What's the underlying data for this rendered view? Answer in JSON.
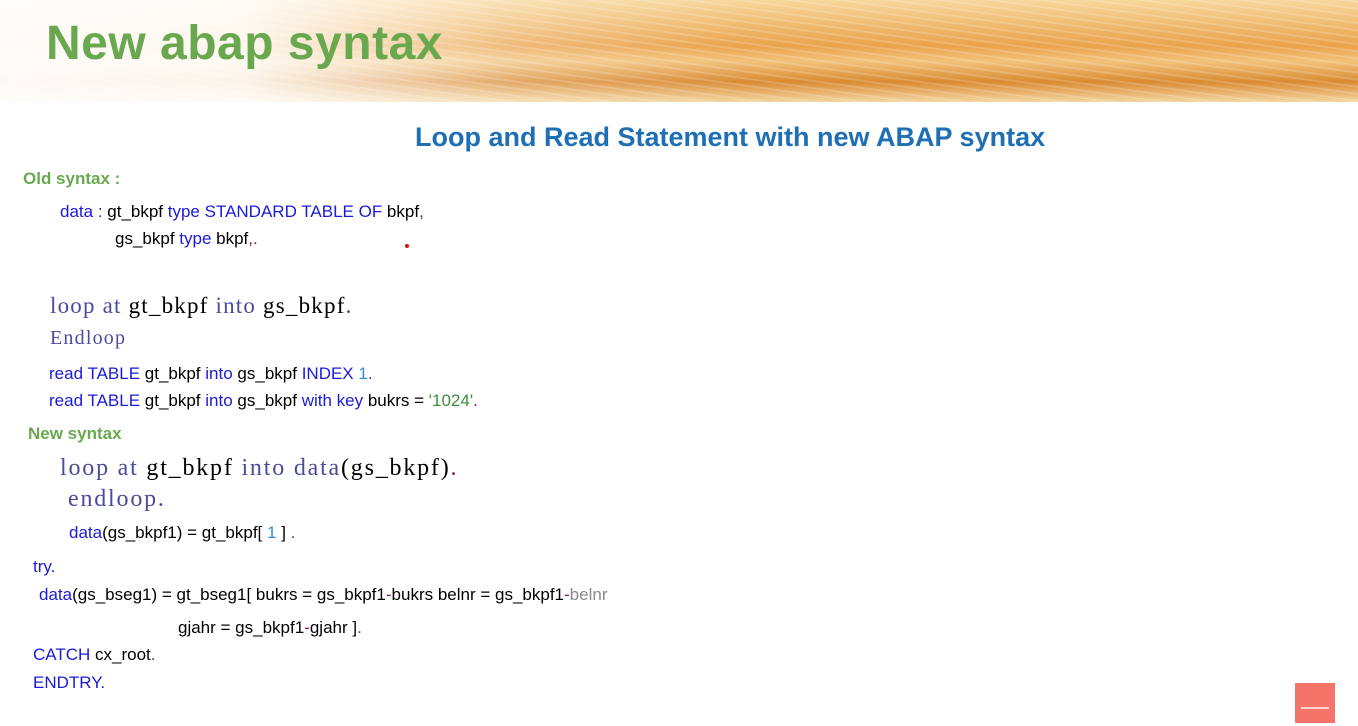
{
  "banner": {
    "title": "New abap syntax"
  },
  "subtitle": "Loop and Read Statement with new ABAP syntax",
  "old_section": {
    "label": "Old syntax :",
    "data_line1": {
      "kw": "data",
      "sep": " : ",
      "var": "gt_bkpf",
      "type_kw": " type STANDARD TABLE OF ",
      "tname": "bkpf",
      "end": ","
    },
    "data_line2": {
      "var": "gs_bkpf",
      "type_kw": " type ",
      "tname": "bkpf",
      "end": ",."
    },
    "loop": {
      "kw1": "loop at",
      "var1": " gt_bkpf ",
      "kw2": "into",
      "var2": " gs_bkpf",
      "end": "."
    },
    "endloop": "Endloop",
    "read1": {
      "kw1": "read TABLE",
      "var1": " gt_bkpf ",
      "kw2": "into",
      "var2": " gs_bkpf ",
      "kw3": "INDEX",
      "num": " 1",
      "end": "."
    },
    "read2": {
      "kw1": "read TABLE",
      "var1": " gt_bkpf ",
      "kw2": "into",
      "var2": " gs_bkpf ",
      "kw3": "with key",
      "var3": " bukrs = ",
      "str": "'1024'",
      "end": "."
    }
  },
  "new_section": {
    "label": "New syntax",
    "loop": {
      "kw1": "loop at",
      "var1": " gt_bkpf ",
      "kw2": "into",
      "kw3": " data",
      "var2": "(gs_bkpf)",
      "end": "."
    },
    "endloop": "endloop.",
    "data_line": {
      "kw": "data",
      "var1": "(gs_bkpf1) = gt_bkpf[ ",
      "num": "1",
      "var2": " ] ",
      "end": "."
    },
    "try": "try.",
    "data_bseg1": {
      "kw": "data",
      "var1": "(gs_bseg1) = gt_bseg1[ bukrs = gs_bkpf1",
      "pur1": "-",
      "var2": "bukrs belnr = gs_bkpf1",
      "pur2": "-",
      "gry": "belnr"
    },
    "data_bseg2": {
      "var1": "gjahr = gs_bkpf1",
      "pur": "-",
      "var2": "gjahr ]",
      "end": "."
    },
    "catch": {
      "kw": "CATCH",
      "var": " cx_root",
      "end": "."
    },
    "endtry": "ENDTRY."
  },
  "colors": {
    "title_green": "#6aa84f",
    "subtitle_blue": "#1f6fb5",
    "keyword_blue": "#1a1adb",
    "corner_button": "#f4746a"
  }
}
